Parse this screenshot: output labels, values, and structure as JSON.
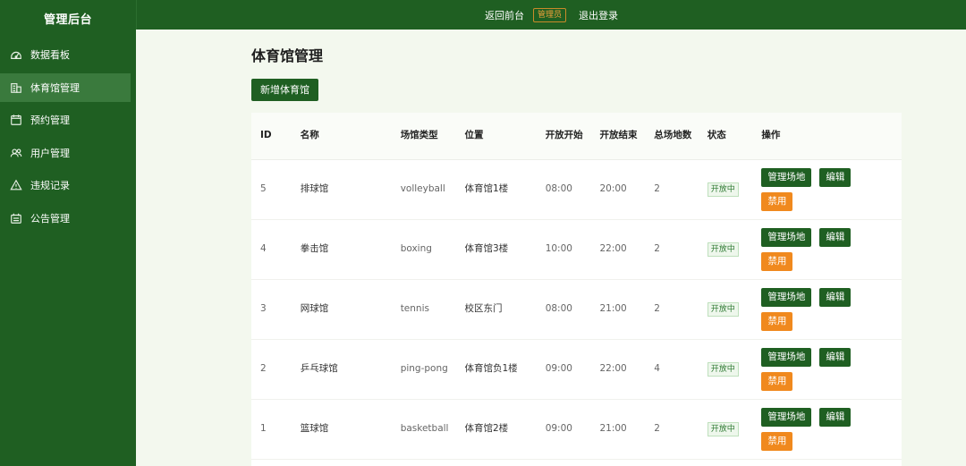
{
  "sidebar": {
    "brand": "管理后台",
    "items": [
      {
        "label": "数据看板",
        "icon": "dashboard-icon"
      },
      {
        "label": "体育馆管理",
        "icon": "building-icon"
      },
      {
        "label": "预约管理",
        "icon": "calendar-icon"
      },
      {
        "label": "用户管理",
        "icon": "users-icon"
      },
      {
        "label": "违规记录",
        "icon": "warning-icon"
      },
      {
        "label": "公告管理",
        "icon": "announcement-icon"
      }
    ],
    "active_index": 1
  },
  "topbar": {
    "back_label": "返回前台",
    "role_badge": "管理员",
    "logout_label": "退出登录"
  },
  "main": {
    "title": "体育馆管理",
    "add_button": "新增体育馆"
  },
  "table": {
    "headers": {
      "id": "ID",
      "name": "名称",
      "type": "场馆类型",
      "location": "位置",
      "open_start": "开放开始",
      "open_end": "开放结束",
      "total_courts": "总场地数",
      "status": "状态",
      "actions": "操作"
    },
    "rows": [
      {
        "id": "5",
        "name": "排球馆",
        "type": "volleyball",
        "location": "体育馆1楼",
        "open_start": "08:00",
        "open_end": "20:00",
        "total_courts": "2",
        "status": "开放中"
      },
      {
        "id": "4",
        "name": "拳击馆",
        "type": "boxing",
        "location": "体育馆3楼",
        "open_start": "10:00",
        "open_end": "22:00",
        "total_courts": "2",
        "status": "开放中"
      },
      {
        "id": "3",
        "name": "网球馆",
        "type": "tennis",
        "location": "校区东门",
        "open_start": "08:00",
        "open_end": "21:00",
        "total_courts": "2",
        "status": "开放中"
      },
      {
        "id": "2",
        "name": "乒乓球馆",
        "type": "ping-pong",
        "location": "体育馆负1楼",
        "open_start": "09:00",
        "open_end": "22:00",
        "total_courts": "4",
        "status": "开放中"
      },
      {
        "id": "1",
        "name": "篮球馆",
        "type": "basketball",
        "location": "体育馆2楼",
        "open_start": "09:00",
        "open_end": "21:00",
        "total_courts": "2",
        "status": "开放中"
      }
    ],
    "action_labels": {
      "manage_courts": "管理场地",
      "edit": "编辑",
      "disable": "禁用"
    }
  },
  "colors": {
    "sidebar_bg": "#1f5f22",
    "active_item": "#3a7a3d",
    "page_bg": "#f3f8ee",
    "primary_button": "#1f5f22",
    "warning_button": "#f0891e",
    "status_green": "#2e7a32"
  }
}
